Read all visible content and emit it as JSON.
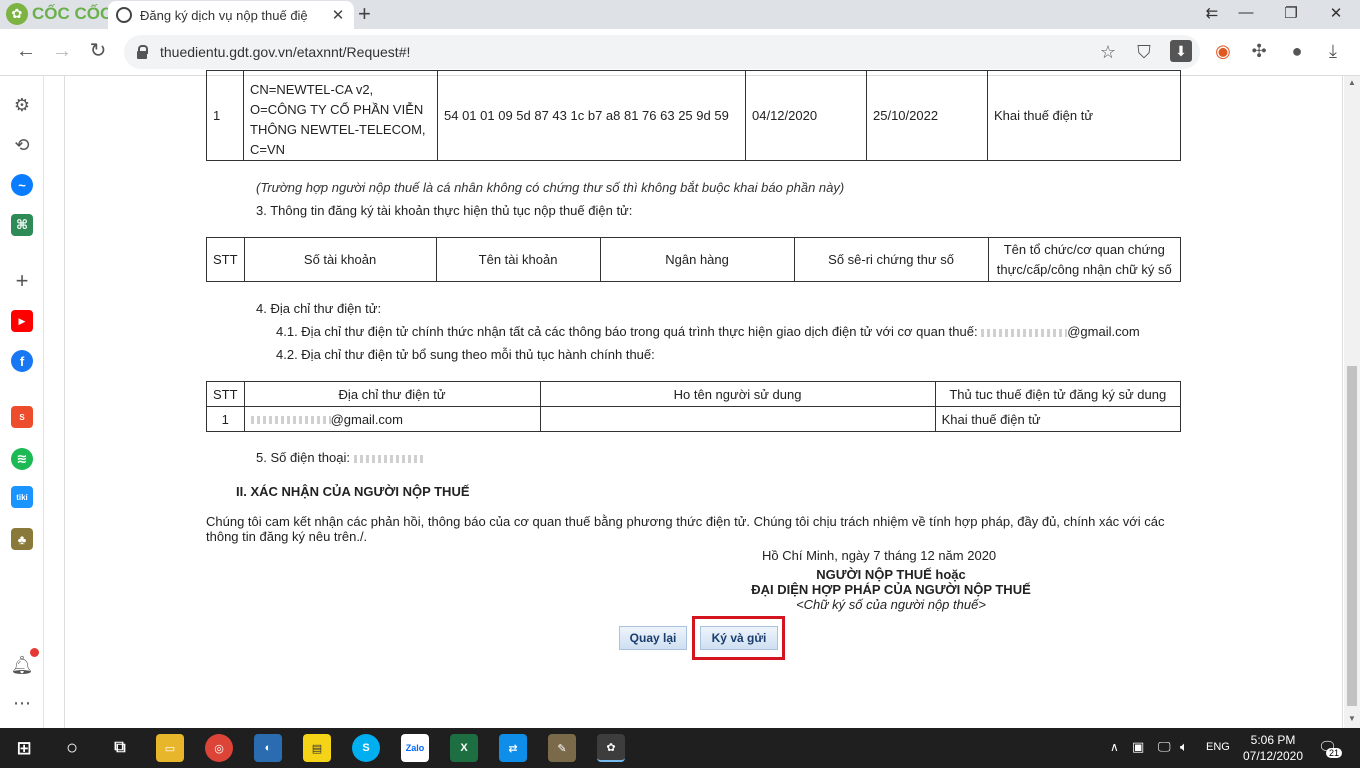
{
  "browser": {
    "brand": "CỐC CỐC",
    "tab_title": "Đăng ký dịch vụ nộp thuế điệ",
    "url": "thuedientu.gdt.gov.vn/etaxnnt/Request#!"
  },
  "cert_row": {
    "stt": "1",
    "subject_lines": [
      "CN=NEWTEL-CA v2,",
      "O=CÔNG TY CỔ PHẦN VIỄN",
      "THÔNG NEWTEL-TELECOM,",
      "C=VN"
    ],
    "serial": "54 01 01 09 5d 87 43 1c b7 a8 81 76 63 25 9d 59",
    "from_date": "04/12/2020",
    "to_date": "25/10/2022",
    "service": "Khai thuế điện tử"
  },
  "note_text": "(Trường hợp người nộp thuế là cá nhân không có chứng thư số thì không bắt buộc khai báo phần này)",
  "section3_title": "3. Thông tin đăng ký tài khoản thực hiện thủ tục nộp thuế điện tử:",
  "bank_headers": {
    "stt": "STT",
    "account_no": "Số tài khoản",
    "account_name": "Tên tài khoản",
    "bank": "Ngân hàng",
    "cert_serial": "Số sê-ri chứng thư số",
    "issuer_line1": "Tên tổ chức/cơ quan chứng",
    "issuer_line2": "thực/cấp/công nhận chữ ký số"
  },
  "section4": {
    "title": "4. Địa chỉ thư điện tử:",
    "line1": "4.1. Địa chỉ thư điện tử chính thức nhận tất cả các thông báo trong quá trình thực hiện giao dịch điện tử với cơ quan thuế:",
    "email1_suffix": "@gmail.com",
    "line2": "4.2. Địa chỉ thư điện tử bổ sung theo mỗi thủ tục hành chính thuế:"
  },
  "email_table": {
    "h_stt": "STT",
    "h_email": "Địa chỉ thư điện tử",
    "h_name": "Ho tên người sử dung",
    "h_proc": "Thủ tuc thuế điện tử đăng ký sử dung",
    "row_stt": "1",
    "row_email_suffix": "@gmail.com",
    "row_proc": "Khai thuế điện tử"
  },
  "phone_label": "5. Số điện thoại:",
  "section2_title": "II. XÁC NHẬN CỦA NGƯỜI NỘP THUẾ",
  "commit_line1": "Chúng tôi cam kết nhận các phản hồi, thông báo của cơ quan thuế bằng phương thức điện tử. Chúng tôi chịu trách nhiệm về tính hợp pháp, đầy đủ, chính xác với các",
  "commit_line2": "thông tin đăng ký nêu trên./.",
  "sign": {
    "place_date": "Hồ Chí Minh, ngày 7 tháng 12 năm 2020",
    "line1": "NGƯỜI NỘP THUẾ hoặc",
    "line2": "ĐẠI DIỆN HỢP PHÁP CỦA NGƯỜI NỘP THUẾ",
    "line3": "<Chữ ký số của người nộp thuế>"
  },
  "buttons": {
    "back": "Quay lại",
    "sign_send": "Ký và gửi"
  },
  "taskbar": {
    "lang": "ENG",
    "time": "5:06 PM",
    "date": "07/12/2020",
    "notif_count": "21"
  },
  "colors": {
    "highlight": "#d4141e",
    "button_text": "#1a3d6d"
  }
}
